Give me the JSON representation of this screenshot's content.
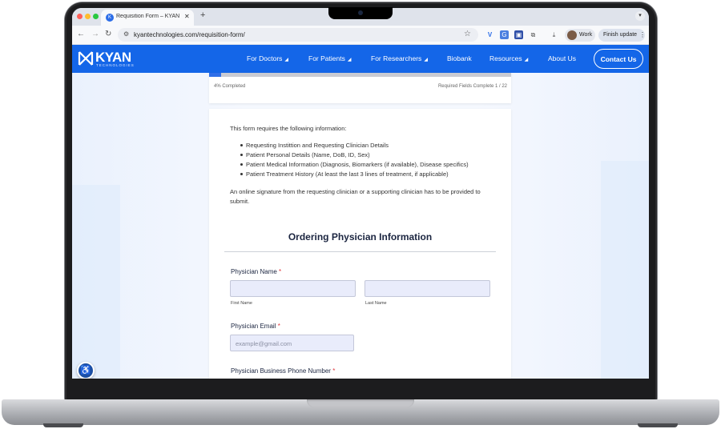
{
  "browser": {
    "tab_title": "Requisition Form – KYAN Technologies",
    "tab_close": "✕",
    "new_tab": "+",
    "url": "kyantechnologies.com/requisition-form/",
    "profile_label": "Work",
    "update_label": "Finish update"
  },
  "site": {
    "logo_text": "KYAN",
    "logo_subtext": "TECHNOLOGIES",
    "nav": [
      {
        "label": "For Doctors",
        "dropdown": true
      },
      {
        "label": "For Patients",
        "dropdown": true
      },
      {
        "label": "For Researchers",
        "dropdown": true
      },
      {
        "label": "Biobank",
        "dropdown": false
      },
      {
        "label": "Resources",
        "dropdown": true
      },
      {
        "label": "About Us",
        "dropdown": false
      }
    ],
    "contact_label": "Contact Us",
    "brand_color": "#1466e8"
  },
  "progress": {
    "percent": 4,
    "completed_label": "4%  Completed",
    "required_label": "Required Fields Complete  1 / 22"
  },
  "form": {
    "intro": "This form requires the following information:",
    "bullets": [
      "Requesting Instittion and Requesting Clinician Details",
      "Patient Personal Details (Name, DoB, ID, Sex)",
      "Patient Medical Information (Diagnosis, Biomarkers (if available), Disease specifics)",
      "Patient Treatment History (At least the last 3 lines of treatment, if applicable)"
    ],
    "signature_note": "An online signature from the requesting clinician or a supporting clinician has to be provided to submit.",
    "section_title": "Ordering Physician Information",
    "physician_name_label": "Physician Name",
    "required_mark": "*",
    "first_name_label": "First Name",
    "last_name_label": "Last Name",
    "first_name_value": "",
    "last_name_value": "",
    "email_label": "Physician Email",
    "email_placeholder": "example@gmail.com",
    "phone_label": "Physician Business Phone Number"
  },
  "icons": {
    "accessibility": "accessibility-icon",
    "star": "bookmark-star-icon"
  }
}
